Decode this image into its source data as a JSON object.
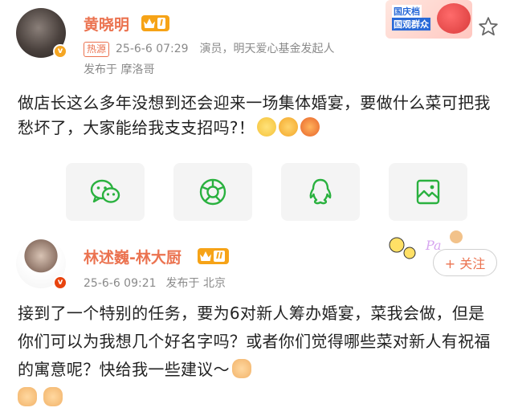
{
  "post1": {
    "name": "黄晓明",
    "level": "I",
    "tag": "热源",
    "time": "25-6-6 07:29",
    "bio": "演员，明天爱心基金发起人",
    "published_from": "发布于 摩洛哥",
    "text": "做店长这么多年没想到还会迎来一场集体婚宴，要做什么菜可把我愁坏了，大家能给我支支招吗?！",
    "banner_line1": "国庆档",
    "banner_line2": "国观群众",
    "share_icons": [
      "wechat-icon",
      "moments-icon",
      "qq-icon",
      "save-image-icon"
    ]
  },
  "post2": {
    "name": "林述巍-林大厨",
    "level": "II",
    "time": "25-6-6 09:21",
    "published_from": "发布于 北京",
    "follow_label": "+ 关注",
    "text": "接到了一个特别的任务，要为6对新人筹办婚宴，菜我会做，但是你们可以为我想几个好名字吗？或者你们觉得哪些菜对新人有祝福的寓意呢？快给我一些建议～"
  },
  "colors": {
    "accent": "#eb7350",
    "share_icon": "#2ab13f",
    "vip": "#f6a317"
  }
}
